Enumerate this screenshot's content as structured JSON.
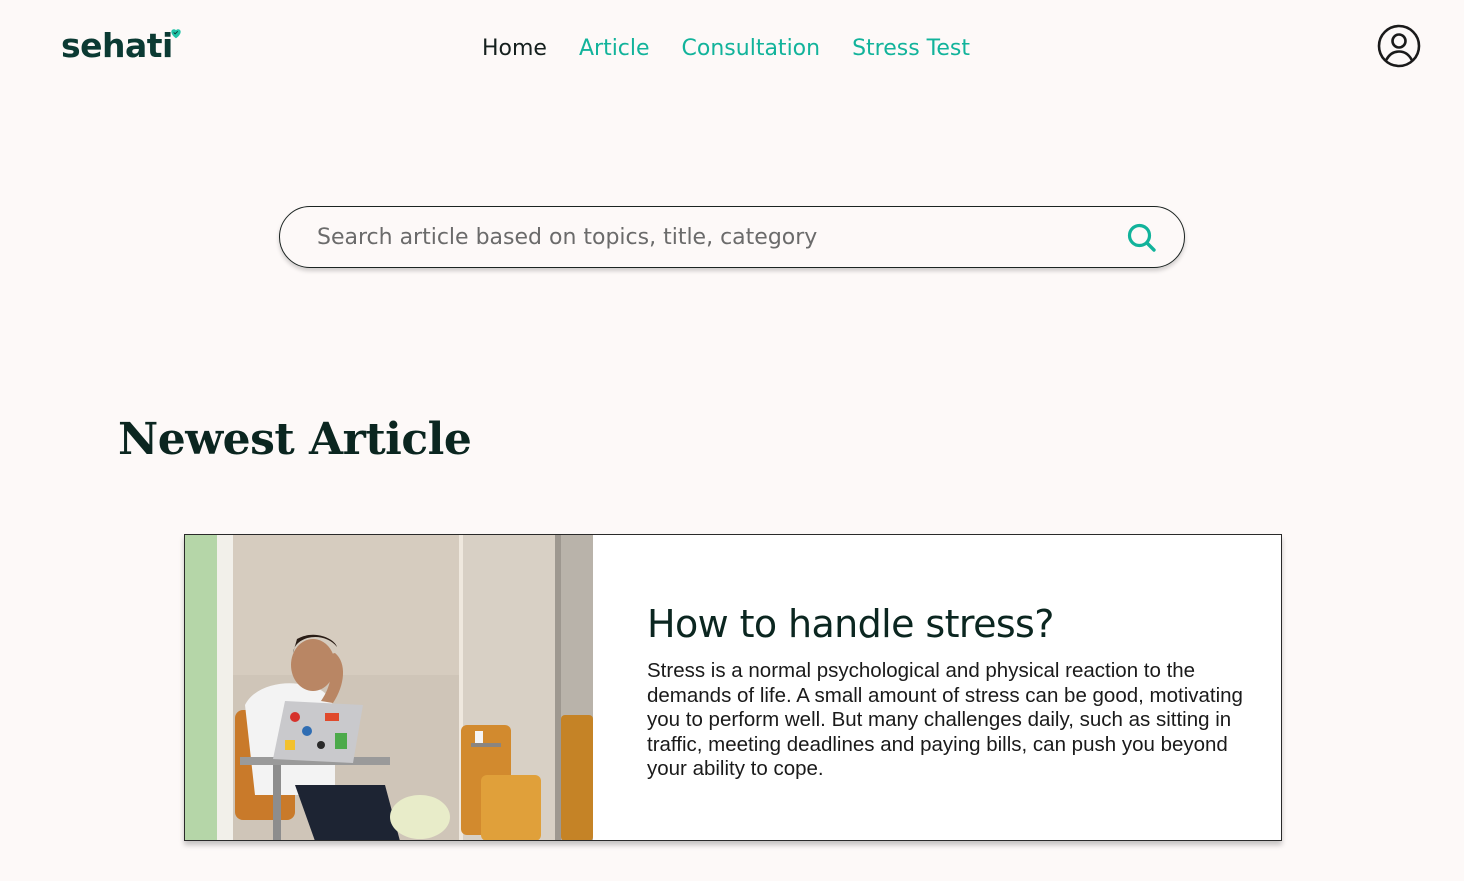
{
  "brand": {
    "name": "sehati",
    "accent_color": "#12b39b",
    "dark_color": "#0b3a33"
  },
  "nav": {
    "items": [
      {
        "label": "Home",
        "active": true
      },
      {
        "label": "Article",
        "active": false
      },
      {
        "label": "Consultation",
        "active": false
      },
      {
        "label": "Stress Test",
        "active": false
      }
    ]
  },
  "header": {
    "profile_icon": "user-circle-icon"
  },
  "search": {
    "placeholder": "Search article based on topics, title, category",
    "value": "",
    "icon": "search-icon"
  },
  "main": {
    "section_title": "Newest Article",
    "articles": [
      {
        "title": "How to handle stress?",
        "excerpt": "Stress is a normal psychological and physical reaction to the demands of life. A small amount of stress can be good, motivating you to perform well. But many challenges daily, such as sitting in traffic, meeting deadlines and paying bills, can push you beyond your ability to cope.",
        "image": "stressed-man-with-laptop-photo"
      }
    ]
  }
}
